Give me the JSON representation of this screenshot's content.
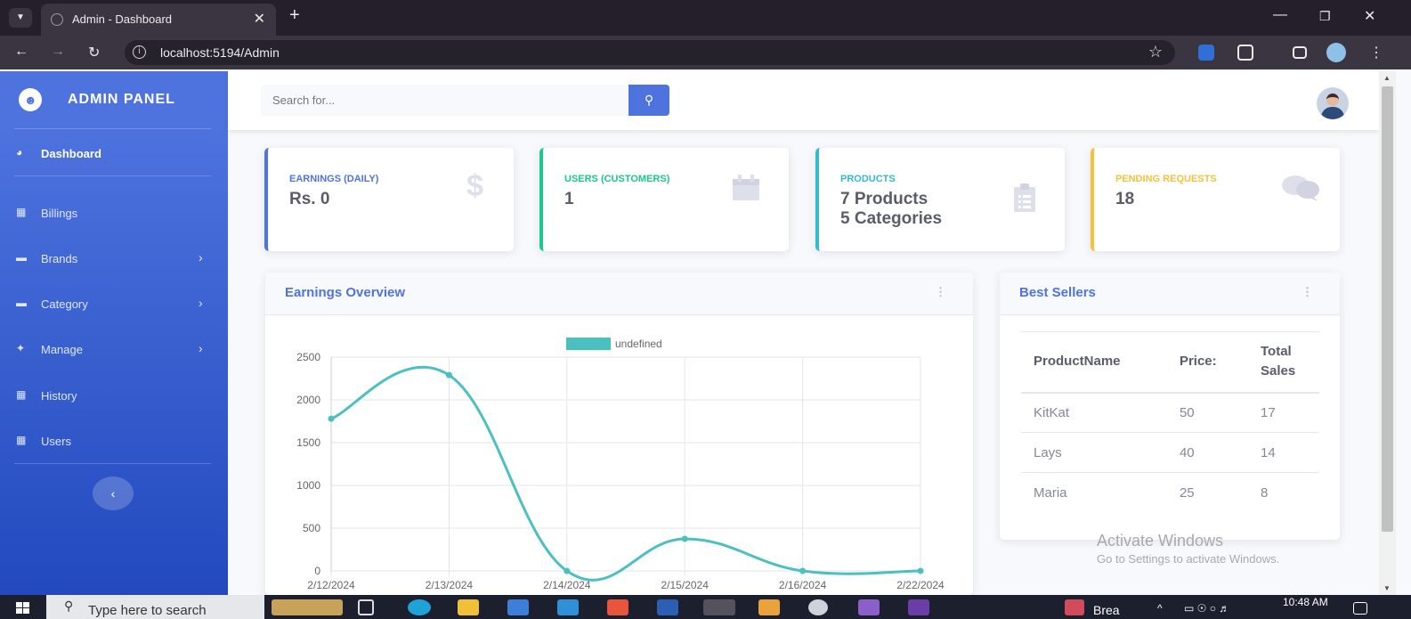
{
  "browser": {
    "tab_title": "Admin - Dashboard",
    "url": "localhost:5194/Admin"
  },
  "sidebar": {
    "brand": "ADMIN PANEL",
    "items": [
      {
        "label": "Dashboard",
        "icon": "tachometer-icon",
        "active": true,
        "has_children": false
      },
      {
        "label": "Billings",
        "icon": "table-icon",
        "active": false,
        "has_children": false
      },
      {
        "label": "Brands",
        "icon": "folder-icon",
        "active": false,
        "has_children": true
      },
      {
        "label": "Category",
        "icon": "folder-icon",
        "active": false,
        "has_children": true
      },
      {
        "label": "Manage",
        "icon": "wrench-icon",
        "active": false,
        "has_children": true
      },
      {
        "label": "History",
        "icon": "table-icon",
        "active": false,
        "has_children": false
      },
      {
        "label": "Users",
        "icon": "table-icon",
        "active": false,
        "has_children": false
      }
    ]
  },
  "topbar": {
    "search_placeholder": "Search for..."
  },
  "cards": [
    {
      "title": "EARNINGS (DAILY)",
      "line1": "Rs. 0",
      "line2": "",
      "color": "#4e73df",
      "icon": "dollar-icon"
    },
    {
      "title": "USERS (CUSTOMERS)",
      "line1": "1",
      "line2": "",
      "color": "#1cc88a",
      "icon": "calendar-icon"
    },
    {
      "title": "PRODUCTS",
      "line1": "7 Products",
      "line2": "5 Categories",
      "color": "#36b9cc",
      "icon": "clipboard-icon"
    },
    {
      "title": "PENDING REQUESTS",
      "line1": "18",
      "line2": "",
      "color": "#f6c23e",
      "icon": "comments-icon"
    }
  ],
  "earnings": {
    "title": "Earnings Overview"
  },
  "chart_data": {
    "type": "line",
    "x": [
      "2/12/2024",
      "2/13/2024",
      "2/14/2024",
      "2/15/2024",
      "2/16/2024",
      "2/22/2024"
    ],
    "series": [
      {
        "name": "undefined",
        "values": [
          1780,
          2290,
          0,
          375,
          0,
          0
        ],
        "color": "#4bc0c0"
      }
    ],
    "yticks": [
      0,
      500,
      1000,
      1500,
      2000,
      2500
    ],
    "ylim": [
      0,
      2500
    ],
    "grid": true,
    "legend": "top"
  },
  "best_sellers": {
    "title": "Best Sellers",
    "columns": [
      "ProductName",
      "Price:",
      "Total Sales"
    ],
    "rows": [
      [
        "KitKat",
        "50",
        "17"
      ],
      [
        "Lays",
        "40",
        "14"
      ],
      [
        "Maria",
        "25",
        "8"
      ]
    ]
  },
  "watermark": {
    "line1": "Activate Windows",
    "line2": "Go to Settings to activate Windows."
  },
  "taskbar": {
    "search_placeholder": "Type here to search",
    "weather_text": "Brea",
    "time": "10:48 AM"
  }
}
